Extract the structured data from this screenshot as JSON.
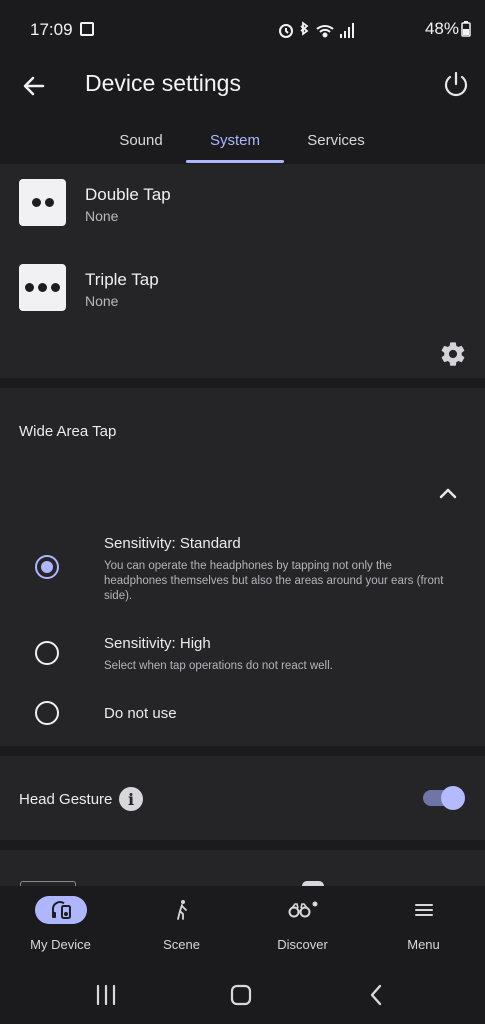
{
  "status_bar": {
    "time": "17:09",
    "battery": "48%",
    "icons": [
      "image-icon",
      "alarm-icon",
      "bluetooth-icon",
      "wifi-icon",
      "signal-icon",
      "battery-icon"
    ]
  },
  "app_bar": {
    "title": "Device settings",
    "back_icon": "arrow-left-icon",
    "power_icon": "power-icon"
  },
  "tabs": [
    {
      "label": "Sound",
      "active": false
    },
    {
      "label": "System",
      "active": true
    },
    {
      "label": "Services",
      "active": false
    }
  ],
  "tap_actions": [
    {
      "title": "Double Tap",
      "value": "None",
      "dots": 2
    },
    {
      "title": "Triple Tap",
      "value": "None",
      "dots": 3
    }
  ],
  "wide_area_tap": {
    "label": "Wide Area Tap",
    "options": [
      {
        "title": "Sensitivity: Standard",
        "description": "You can operate the headphones by tapping not only the headphones themselves but also the areas around your ears (front side).",
        "selected": true
      },
      {
        "title": "Sensitivity: High",
        "description": "Select when tap operations do not react well.",
        "selected": false
      },
      {
        "title": "Do not use",
        "description": "",
        "selected": false
      }
    ]
  },
  "head_gesture": {
    "label": "Head Gesture",
    "enabled": true
  },
  "bottom_nav": [
    {
      "label": "My Device",
      "icon": "headphones-device-icon",
      "active": true
    },
    {
      "label": "Scene",
      "icon": "walking-person-icon",
      "active": false
    },
    {
      "label": "Discover",
      "icon": "binoculars-icon",
      "active": false
    },
    {
      "label": "Menu",
      "icon": "hamburger-menu-icon",
      "active": false
    }
  ],
  "colors": {
    "background": "#1b1b1d",
    "card": "#252527",
    "accent": "#aeb6ff"
  }
}
